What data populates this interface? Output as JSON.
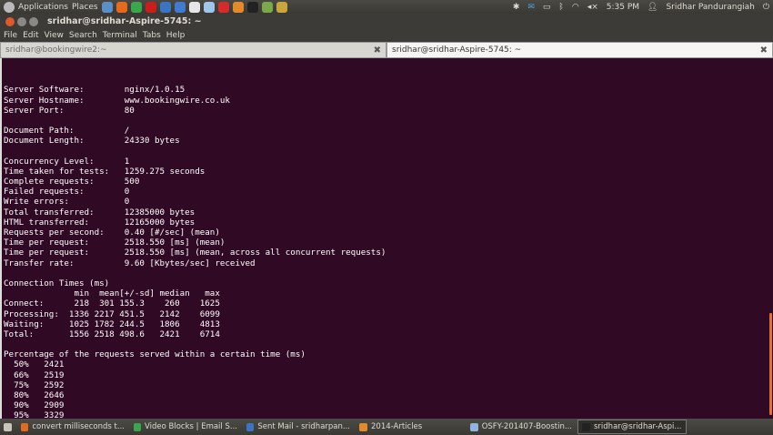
{
  "topbar": {
    "applications": "Applications",
    "places": "Places",
    "time": "5:35 PM",
    "user": "Sridhar Pandurangiah"
  },
  "launchers": [
    {
      "name": "thunderbird-icon",
      "color": "#5a8fc7"
    },
    {
      "name": "firefox-icon",
      "color": "#e66a1e"
    },
    {
      "name": "chrome-icon",
      "color": "#3aa84a"
    },
    {
      "name": "opera-icon",
      "color": "#cc1d1d"
    },
    {
      "name": "mail-client-icon",
      "color": "#3b74c4"
    },
    {
      "name": "writer-icon",
      "color": "#3f7bd0"
    },
    {
      "name": "text-editor-icon",
      "color": "#e6e6e6"
    },
    {
      "name": "chart-icon",
      "color": "#9fc6e8"
    },
    {
      "name": "diagram-icon",
      "color": "#d52b2b"
    },
    {
      "name": "home-folder-icon",
      "color": "#e38a2a"
    },
    {
      "name": "terminal-icon",
      "color": "#222222"
    },
    {
      "name": "system-monitor-icon",
      "color": "#7aa84a"
    },
    {
      "name": "tools-icon",
      "color": "#c9a63c"
    }
  ],
  "window": {
    "title": "sridhar@sridhar-Aspire-5745: ~",
    "menu": [
      "File",
      "Edit",
      "View",
      "Search",
      "Terminal",
      "Tabs",
      "Help"
    ],
    "tabs": [
      {
        "label": "sridhar@bookingwire2:~",
        "active": false
      },
      {
        "label": "sridhar@sridhar-Aspire-5745: ~",
        "active": true
      }
    ]
  },
  "terminal": {
    "lines": [
      "",
      "",
      "Server Software:        nginx/1.0.15",
      "Server Hostname:        www.bookingwire.co.uk",
      "Server Port:            80",
      "",
      "Document Path:          /",
      "Document Length:        24330 bytes",
      "",
      "Concurrency Level:      1",
      "Time taken for tests:   1259.275 seconds",
      "Complete requests:      500",
      "Failed requests:        0",
      "Write errors:           0",
      "Total transferred:      12385000 bytes",
      "HTML transferred:       12165000 bytes",
      "Requests per second:    0.40 [#/sec] (mean)",
      "Time per request:       2518.550 [ms] (mean)",
      "Time per request:       2518.550 [ms] (mean, across all concurrent requests)",
      "Transfer rate:          9.60 [Kbytes/sec] received",
      "",
      "Connection Times (ms)",
      "              min  mean[+/-sd] median   max",
      "Connect:      218  301 155.3    260    1625",
      "Processing:  1336 2217 451.5   2142    6099",
      "Waiting:     1025 1782 244.5   1806    4813",
      "Total:       1556 2518 498.6   2421    6714",
      "",
      "Percentage of the requests served within a certain time (ms)",
      "  50%   2421",
      "  66%   2519",
      "  75%   2592",
      "  80%   2646",
      "  90%   2909",
      "  95%   3329"
    ]
  },
  "taskbar": [
    {
      "label": "convert milliseconds t...",
      "icon": "firefox-icon",
      "color": "#e66a1e",
      "active": false
    },
    {
      "label": "Video Blocks | Email S...",
      "icon": "chrome-icon",
      "color": "#3aa84a",
      "active": false
    },
    {
      "label": "Sent Mail - sridharpan...",
      "icon": "mail-client-icon",
      "color": "#3b74c4",
      "active": false
    },
    {
      "label": "2014-Articles",
      "icon": "folder-icon",
      "color": "#e38a2a",
      "active": false
    },
    {
      "label": "OSFY-201407-Boostin...",
      "icon": "document-icon",
      "color": "#8fb4e0",
      "active": false
    },
    {
      "label": "sridhar@sridhar-Aspi...",
      "icon": "terminal-icon",
      "color": "#222222",
      "active": true
    }
  ]
}
